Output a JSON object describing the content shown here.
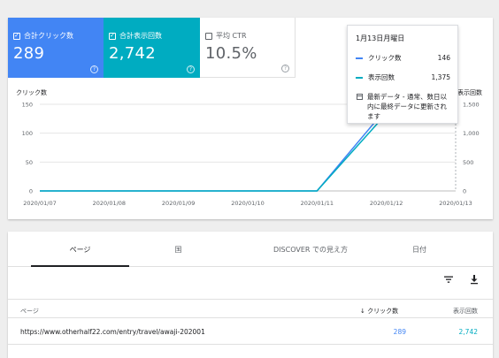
{
  "metrics": {
    "clicks": {
      "label": "合計クリック数",
      "value": "289",
      "checked": true
    },
    "impressions": {
      "label": "合計表示回数",
      "value": "2,742",
      "checked": true
    },
    "ctr": {
      "label": "平均 CTR",
      "value": "10.5%",
      "checked": false
    },
    "help_glyph": "?"
  },
  "tooltip": {
    "date": "1月13日月曜日",
    "rows": [
      {
        "label": "クリック数",
        "value": "146",
        "color": "#4285f4"
      },
      {
        "label": "表示回数",
        "value": "1,375",
        "color": "#00acc1"
      }
    ],
    "note": "最新データ - 通常、数日以内に最終データに更新されます"
  },
  "chart_data": {
    "type": "line",
    "left_axis_label": "クリック数",
    "right_axis_label": "表示回数",
    "categories": [
      "2020/01/07",
      "2020/01/08",
      "2020/01/09",
      "2020/01/10",
      "2020/01/11",
      "2020/01/12",
      "2020/01/13"
    ],
    "y_left_ticks": [
      "150",
      "100",
      "50",
      "0"
    ],
    "y_right_ticks": [
      "1,500",
      "1,000",
      "500",
      "0"
    ],
    "ylim_left": [
      0,
      150
    ],
    "ylim_right": [
      0,
      1500
    ],
    "series": [
      {
        "name": "クリック数",
        "axis": "left",
        "color": "#4285f4",
        "values": [
          0,
          0,
          0,
          0,
          0,
          143,
          146
        ]
      },
      {
        "name": "表示回数",
        "axis": "right",
        "color": "#00acc1",
        "values": [
          0,
          0,
          0,
          0,
          0,
          1340,
          1375
        ]
      }
    ],
    "grid": true,
    "hover_index": 6
  },
  "tabs": [
    {
      "label": "ページ",
      "active": true
    },
    {
      "label": "国",
      "active": false
    },
    {
      "label": "DISCOVER での見え方",
      "active": false
    },
    {
      "label": "日付",
      "active": false
    }
  ],
  "tools": {
    "filter_icon": "filter-icon",
    "download_icon": "download-icon"
  },
  "table": {
    "headers": {
      "page": "ページ",
      "sort_arrow": "↓",
      "clicks": "クリック数",
      "impressions": "表示回数"
    },
    "rows": [
      {
        "page": "https://www.otherhalf22.com/entry/travel/awaji-202001",
        "clicks": "289",
        "impressions": "2,742"
      }
    ]
  }
}
